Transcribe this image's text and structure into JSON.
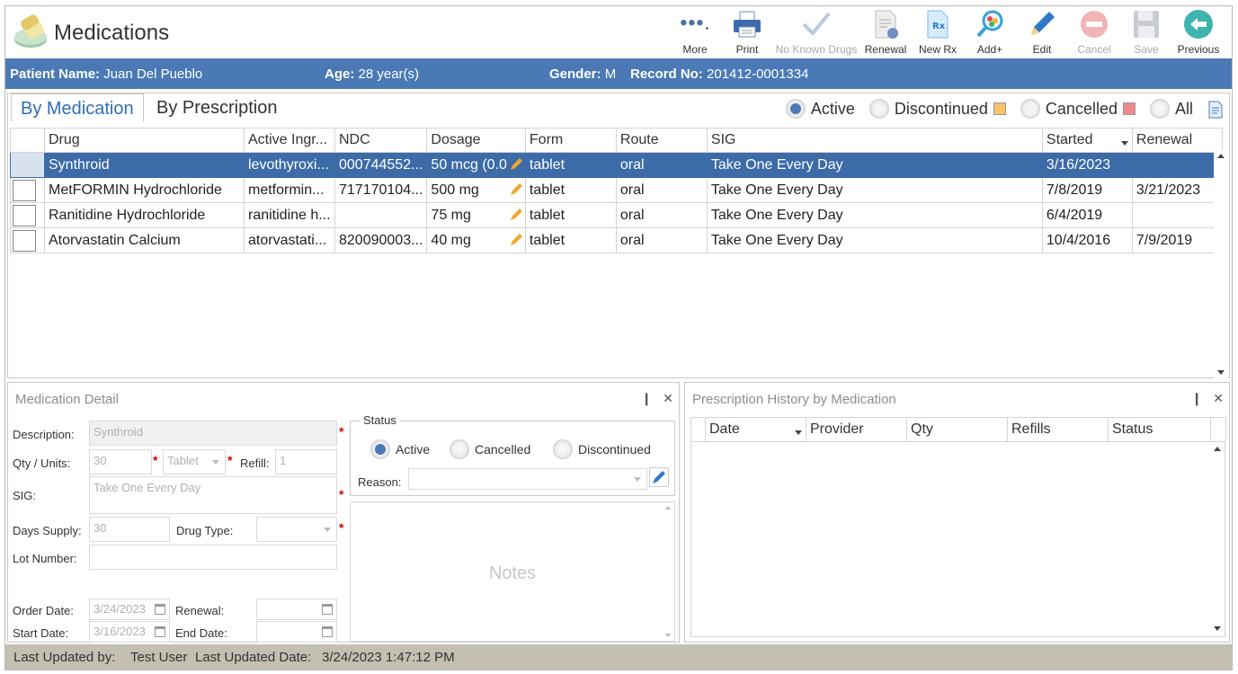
{
  "app": {
    "title": "Medications",
    "logo_icon": "pill-bottle-icon"
  },
  "toolbar": [
    {
      "label": "More",
      "icon": "more-dots-icon",
      "disabled": false
    },
    {
      "label": "Print",
      "icon": "printer-icon",
      "disabled": false
    },
    {
      "label": "No Known Drugs",
      "icon": "checkmark-icon",
      "disabled": true
    },
    {
      "label": "Renewal",
      "icon": "document-renew-icon",
      "disabled": false
    },
    {
      "label": "New Rx",
      "icon": "new-rx-icon",
      "disabled": false
    },
    {
      "label": "Add+",
      "icon": "add-search-icon",
      "disabled": false
    },
    {
      "label": "Edit",
      "icon": "pencil-icon",
      "disabled": false
    },
    {
      "label": "Cancel",
      "icon": "cancel-circle-icon",
      "disabled": true
    },
    {
      "label": "Save",
      "icon": "floppy-disk-icon",
      "disabled": true
    },
    {
      "label": "Previous",
      "icon": "back-arrow-icon",
      "disabled": false
    }
  ],
  "patient": {
    "name_label": "Patient Name:",
    "name": "Juan Del Pueblo",
    "age_label": "Age:",
    "age": "28 year(s)",
    "gender_label": "Gender:",
    "gender": "M",
    "record_label": "Record No:",
    "record": "201412-0001334"
  },
  "tabs": {
    "by_medication": "By Medication",
    "by_prescription": "By Prescription"
  },
  "filters": {
    "active": "Active",
    "discontinued": "Discontinued",
    "cancelled": "Cancelled",
    "all": "All",
    "discontinued_color": "#f7c16b",
    "cancelled_color": "#f08a8a"
  },
  "grid": {
    "columns": [
      "Drug",
      "Active Ingr...",
      "NDC",
      "Dosage",
      "Form",
      "Route",
      "SIG",
      "Started",
      "Renewal"
    ],
    "rows": [
      {
        "drug": "Synthroid",
        "ingredient": "levothyroxi...",
        "ndc": "000744552...",
        "dosage": "50 mcg (0.0",
        "form": "tablet",
        "route": "oral",
        "sig": "Take One Every Day",
        "started": "3/16/2023",
        "renewal": ""
      },
      {
        "drug": "MetFORMIN Hydrochloride",
        "ingredient": "metformin...",
        "ndc": "717170104...",
        "dosage": "500 mg",
        "form": "tablet",
        "route": "oral",
        "sig": "Take One Every Day",
        "started": "7/8/2019",
        "renewal": "3/21/2023"
      },
      {
        "drug": "Ranitidine Hydrochloride",
        "ingredient": "ranitidine h...",
        "ndc": "",
        "dosage": "75 mg",
        "form": "tablet",
        "route": "oral",
        "sig": "Take One Every Day",
        "started": "6/4/2019",
        "renewal": ""
      },
      {
        "drug": "Atorvastatin Calcium",
        "ingredient": "atorvastati...",
        "ndc": "820090003...",
        "dosage": "40 mg",
        "form": "tablet",
        "route": "oral",
        "sig": "Take One Every Day",
        "started": "10/4/2016",
        "renewal": "7/9/2019"
      }
    ]
  },
  "detail": {
    "title": "Medication Detail",
    "description_label": "Description:",
    "description": "Synthroid",
    "qty_label": "Qty / Units:",
    "qty": "30",
    "units": "Tablet",
    "refill_label": "Refill:",
    "refill": "1",
    "sig_label": "SIG:",
    "sig": "Take One Every Day",
    "days_supply_label": "Days Supply:",
    "days_supply": "30",
    "drug_type_label": "Drug Type:",
    "drug_type": "",
    "lot_label": "Lot Number:",
    "lot": "",
    "order_date_label": "Order Date:",
    "order_date": "3/24/2023",
    "renewal_label": "Renewal:",
    "renewal": "",
    "start_date_label": "Start Date:",
    "start_date": "3/16/2023",
    "end_date_label": "End Date:",
    "end_date": "",
    "status_legend": "Status",
    "status_active": "Active",
    "status_cancelled": "Cancelled",
    "status_discontinued": "Discontinued",
    "reason_label": "Reason:",
    "reason": "",
    "notes_placeholder": "Notes",
    "pin_glyph": "❙",
    "close_glyph": "✕"
  },
  "history": {
    "title": "Prescription History by Medication",
    "columns": [
      "Date",
      "Provider",
      "Qty",
      "Refills",
      "Status"
    ]
  },
  "footer": {
    "updated_by_label": "Last Updated by:",
    "updated_by": "Test User",
    "updated_date_label": "Last Updated Date:",
    "updated_date": "3/24/2023 1:47:12 PM"
  }
}
